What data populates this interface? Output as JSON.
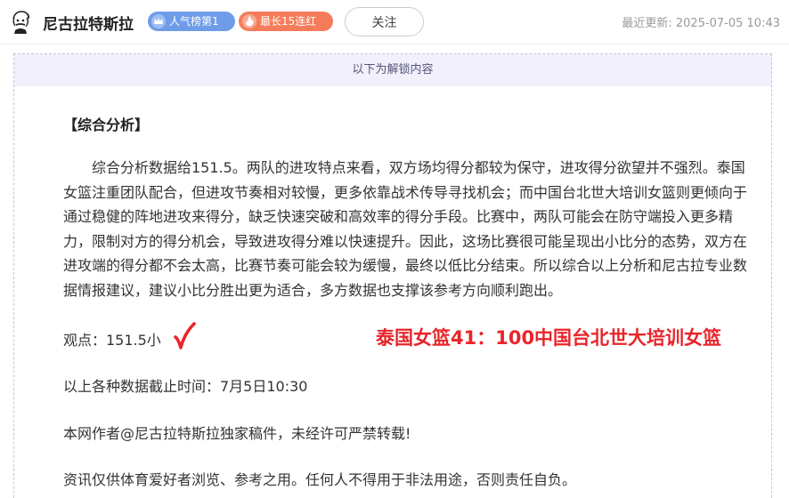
{
  "header": {
    "author_name": "尼古拉特斯拉",
    "badges": [
      {
        "label": "人气榜第1",
        "color": "#6e9ce9"
      },
      {
        "label": "最长15连红",
        "color": "#f57c5a"
      }
    ],
    "follow_label": "关注",
    "update_label": "最近更新:",
    "update_time": "2025-07-05 10:43"
  },
  "content": {
    "unlock_notice": "以下为解锁内容",
    "section_title": "【综合分析】",
    "analysis": "综合分析数据给151.5。两队的进攻特点来看，双方场均得分都较为保守，进攻得分欲望并不强烈。泰国女篮注重团队配合，但进攻节奏相对较慢，更多依靠战术传导寻找机会；而中国台北世大培训女篮则更倾向于通过稳健的阵地进攻来得分，缺乏快速突破和高效率的得分手段。比赛中，两队可能会在防守端投入更多精力，限制对方的得分机会，导致进攻得分难以快速提升。因此，这场比赛很可能呈现出小比分的态势，双方在进攻端的得分都不会太高，比赛节奏可能会较为缓慢，最终以低比分结束。所以综合以上分析和尼古拉专业数据情报建议，建议小比分胜出更为适合，多方数据也支撑该参考方向顺利跑出。",
    "viewpoint": "观点：151.5小",
    "score_overlay": "泰国女篮41：100中国台北世大培训女篮",
    "data_cutoff": "以上各种数据截止时间：7月5日10:30",
    "copyright": "本网作者@尼古拉特斯拉独家稿件，未经许可严禁转载!",
    "disclaimer": "资讯仅供体育爱好者浏览、参考之用。任何人不得用于非法用途，否则责任自负。"
  },
  "colors": {
    "accent_red": "#e8252b",
    "unlock_bg": "#f2f0fb",
    "card_border": "#c7c0e8"
  },
  "icons": {
    "avatar": "portrait-sketch-icon",
    "rank_badge": "crown-icon",
    "streak_badge": "flame-icon",
    "check": "checkmark-icon"
  }
}
